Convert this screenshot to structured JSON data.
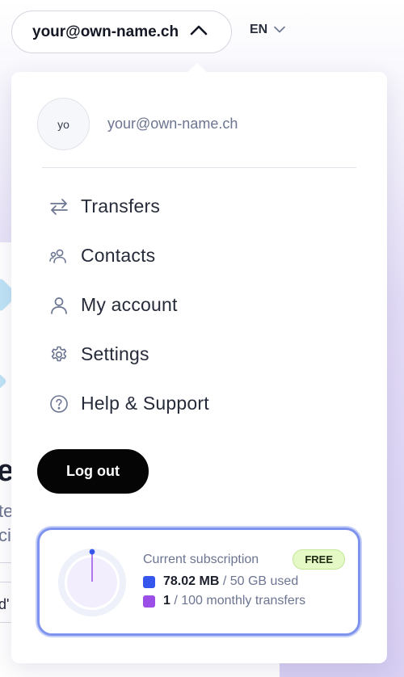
{
  "header": {
    "user_email": "your@own-name.ch",
    "language": "EN"
  },
  "profile": {
    "avatar_initials": "yo",
    "email": "your@own-name.ch"
  },
  "menu": {
    "items": [
      {
        "label": "Transfers",
        "icon": "transfer-arrows-icon"
      },
      {
        "label": "Contacts",
        "icon": "contacts-icon"
      },
      {
        "label": "My account",
        "icon": "user-icon"
      },
      {
        "label": "Settings",
        "icon": "gear-icon"
      },
      {
        "label": "Help & Support",
        "icon": "help-circle-icon"
      }
    ],
    "logout_label": "Log out"
  },
  "subscription": {
    "title": "Current subscription",
    "plan_badge": "FREE",
    "storage_used": "78.02 MB",
    "storage_total": "/ 50 GB used",
    "transfers_used": "1",
    "transfers_total": "/ 100 monthly transfers",
    "storage_color": "#3557ee",
    "transfers_color": "#9b4fe6",
    "storage_fraction": 0.0016
  },
  "background": {
    "heading_fragment": "ea",
    "text_fragment_1": "te",
    "text_fragment_2": "ci",
    "text_fragment_3": "d'"
  }
}
